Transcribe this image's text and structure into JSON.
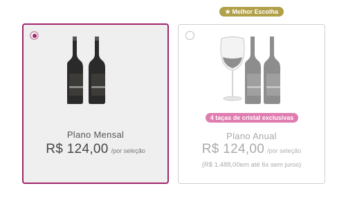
{
  "best_choice_badge": {
    "icon": "star-icon",
    "icon_glyph": "★",
    "label": "Melhor Escolha",
    "color": "#b0a048"
  },
  "plans": [
    {
      "name": "Plano Mensal",
      "price": "R$ 124,00",
      "per_selection": "/por seleção",
      "selected": true,
      "accent": "#a0246b"
    },
    {
      "name": "Plano Anual",
      "price": "R$ 124,00",
      "per_selection": "/por seleção",
      "installments": "(R$ 1.488,00em até 6x sem juros)",
      "gift_badge": "4 taças de cristal exclusivas",
      "gift_badge_color": "#e07cb0",
      "selected": false
    }
  ]
}
